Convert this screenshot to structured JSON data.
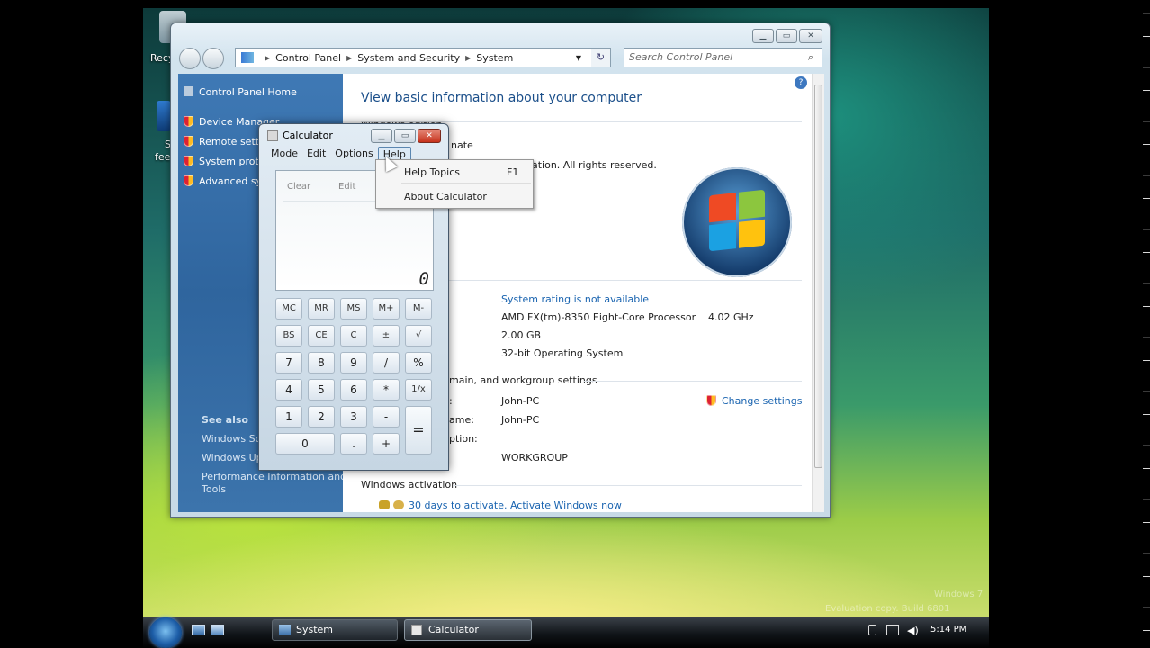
{
  "desktop": {
    "icons": [
      {
        "label": "Recy",
        "name": "recycle-bin-icon"
      },
      {
        "label": "S",
        "name": "feedback-icon"
      },
      {
        "label": "fee",
        "name": "feedback-label"
      }
    ],
    "watermark": [
      "Windows 7",
      "Evaluation copy. Build 6801"
    ]
  },
  "control_panel": {
    "breadcrumb": [
      "Control Panel",
      "System and Security",
      "System"
    ],
    "search_placeholder": "Search Control Panel",
    "sidebar": {
      "home": "Control Panel Home",
      "items": [
        "Device Manager",
        "Remote setti",
        "System prote",
        "Advanced sy"
      ],
      "see_also_title": "See also",
      "see_also": [
        "Windows So",
        "Windows Up",
        "Performance Information and",
        "Tools"
      ]
    },
    "heading": "View basic information about your computer",
    "edition_heading": "Windows edition",
    "edition_line": "nate",
    "copyright": "ation.  All rights reserved.",
    "system": {
      "rating": "System rating is not available",
      "processor": "AMD FX(tm)-8350 Eight-Core Processor",
      "speed": "4.02 GHz",
      "ram": "2.00 GB",
      "type": "32-bit Operating System"
    },
    "network": {
      "title": "main, and workgroup settings",
      "label_name": ":",
      "computer_name": "John-PC",
      "label_full": "ame:",
      "full_name": "John-PC",
      "label_desc": "ption:",
      "workgroup": "WORKGROUP",
      "change_settings": "Change settings"
    },
    "activation": {
      "title": "Windows activation",
      "link": "30 days to activate. Activate Windows now"
    }
  },
  "calculator": {
    "title": "Calculator",
    "menu": [
      "Mode",
      "Edit",
      "Options",
      "Help"
    ],
    "display_buttons": [
      "Clear",
      "Edit"
    ],
    "display_value": "0",
    "keys": {
      "row1": [
        "MC",
        "MR",
        "MS",
        "M+",
        "M-"
      ],
      "row2": [
        "BS",
        "CE",
        "C",
        "±",
        "√"
      ],
      "row3": [
        "7",
        "8",
        "9",
        "/",
        "%"
      ],
      "row4": [
        "4",
        "5",
        "6",
        "*",
        "1/x"
      ],
      "row5": [
        "1",
        "2",
        "3",
        "-",
        "="
      ],
      "row6": [
        "0",
        ".",
        "+"
      ]
    }
  },
  "help_menu": {
    "items": [
      {
        "label": "Help Topics",
        "shortcut": "F1"
      },
      {
        "label": "About Calculator",
        "shortcut": ""
      }
    ]
  },
  "taskbar": {
    "buttons": [
      "System",
      "Calculator"
    ],
    "clock": "5:14 PM"
  }
}
